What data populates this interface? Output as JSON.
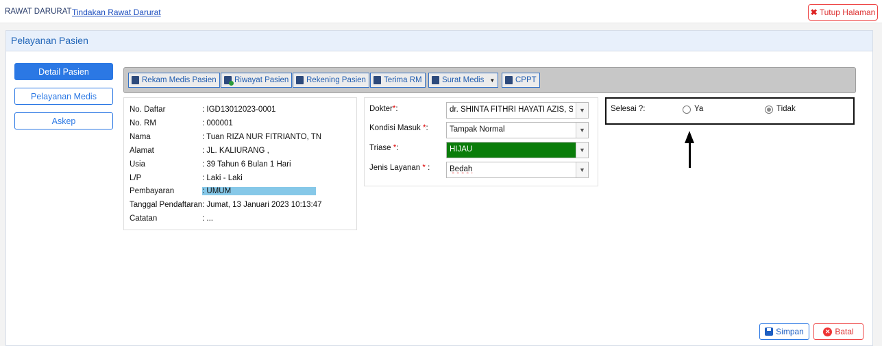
{
  "breadcrumb": {
    "section": "RAWAT DARURAT",
    "page": "Tindakan Rawat Darurat"
  },
  "close_page": {
    "icon": "close-icon",
    "label": "Tutup Halaman"
  },
  "panel": {
    "title": "Pelayanan Pasien"
  },
  "sidebar": {
    "items": [
      {
        "label": "Detail Pasien",
        "active": true
      },
      {
        "label": "Pelayanan Medis",
        "active": false
      },
      {
        "label": "Askep",
        "active": false
      }
    ]
  },
  "toolbar": {
    "buttons": [
      {
        "label": "Rekam Medis Pasien",
        "icon": "file-icon"
      },
      {
        "label": "Riwayat Pasien",
        "icon": "history-file-icon"
      },
      {
        "label": "Rekening Pasien",
        "icon": "credit-card-icon"
      },
      {
        "label": "Terima RM",
        "icon": "inbox-icon"
      },
      {
        "label": "Surat Medis",
        "icon": "document-plus-icon",
        "dropdown": true
      },
      {
        "label": "CPPT",
        "icon": "notes-icon"
      }
    ]
  },
  "patient": {
    "rows": [
      {
        "label": "No. Daftar",
        "value": ": IGD13012023-0001"
      },
      {
        "label": "No. RM",
        "value": ": 000001"
      },
      {
        "label": "Nama",
        "value": ": Tuan RIZA NUR FITRIANTO, TN"
      },
      {
        "label": "Alamat",
        "value": ": JL. KALIURANG ,"
      },
      {
        "label": "Usia",
        "value": ": 39 Tahun 6 Bulan 1 Hari"
      },
      {
        "label": "L/P",
        "value": ": Laki - Laki"
      },
      {
        "label": "Pembayaran",
        "value": ": UMUM"
      },
      {
        "label": "Tanggal Pendaftaran",
        "value": ": Jumat, 13 Januari 2023 10:13:47"
      },
      {
        "label": "Catatan",
        "value": ": ..."
      }
    ]
  },
  "medical": {
    "doctor": {
      "label": "Dokter",
      "req": "*",
      "suffix": ":",
      "value": "dr. SHINTA FITHRI HAYATI AZIS, Sp.N"
    },
    "condition": {
      "label": "Kondisi Masuk",
      "req": "*",
      "suffix": ":",
      "value": "Tampak Normal"
    },
    "triage": {
      "label": "Triase",
      "req": "*",
      "suffix": ":",
      "value": "HIJAU",
      "color": "#0a7d0a"
    },
    "service": {
      "label": "Jenis Layanan",
      "req": "*",
      "suffix": ":",
      "value": "Bedah"
    }
  },
  "completion": {
    "label": "Selesai ?:",
    "options": [
      {
        "label": "Ya",
        "checked": false
      },
      {
        "label": "Tidak",
        "checked": true
      }
    ]
  },
  "footer": {
    "save_label": "Simpan",
    "cancel_label": "Batal"
  },
  "colors": {
    "primary": "#2b78e4",
    "danger": "#e44444",
    "triage_green": "#0a7d0a",
    "highlight": "#86c8e8"
  }
}
